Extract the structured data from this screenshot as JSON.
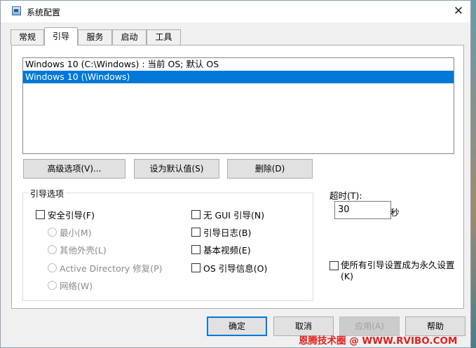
{
  "window": {
    "title": "系统配置",
    "close_glyph": "✕"
  },
  "tabs": [
    {
      "label": "常规"
    },
    {
      "label": "引导"
    },
    {
      "label": "服务"
    },
    {
      "label": "启动"
    },
    {
      "label": "工具"
    }
  ],
  "active_tab": "引导",
  "os_list": [
    {
      "label": "Windows 10 (C:\\Windows) : 当前 OS; 默认 OS",
      "selected": false
    },
    {
      "label": "Windows 10 (\\Windows)",
      "selected": true
    }
  ],
  "os_buttons": {
    "advanced": "高级选项(V)...",
    "set_default": "设为默认值(S)",
    "delete": "删除(D)"
  },
  "boot_options": {
    "title": "引导选项",
    "safe_boot": "安全引导(F)",
    "minimal": "最小(M)",
    "alternate_shell": "其他外壳(L)",
    "active_directory": "Active Directory 修复(P)",
    "network": "网络(W)",
    "no_gui": "无 GUI 引导(N)",
    "boot_log": "引导日志(B)",
    "base_video": "基本视频(E)",
    "os_boot_info": "OS 引导信息(O)"
  },
  "timeout": {
    "label": "超时(T):",
    "value": "30",
    "unit": "秒"
  },
  "make_permanent": "使所有引导设置成为永久设置(K)",
  "dialog_buttons": {
    "ok": "确定",
    "cancel": "取消",
    "apply": "应用(A)",
    "help": "帮助"
  },
  "watermark": "恩腾技术圈 @ WWW.RVIBO.COM",
  "colors": {
    "selection": "#0078d7",
    "watermark": "#e02020"
  }
}
